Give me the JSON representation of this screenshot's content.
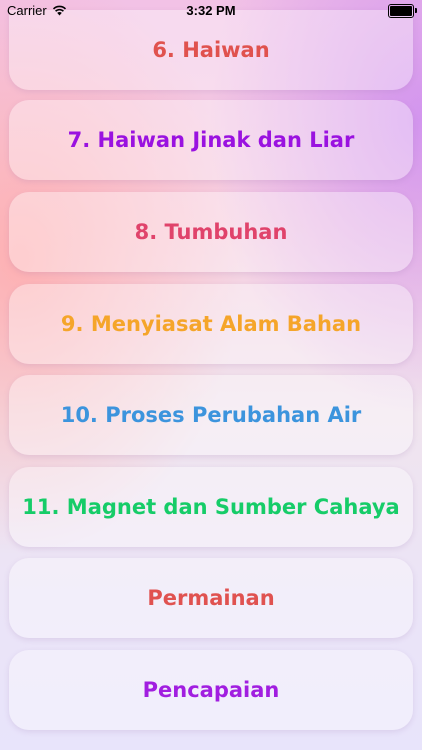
{
  "status_bar": {
    "carrier": "Carrier",
    "time": "3:32 PM",
    "battery_level": 1.0
  },
  "menu": {
    "items": [
      {
        "label": "6. Haiwan",
        "color": "#e0524e"
      },
      {
        "label": "7. Haiwan Jinak dan Liar",
        "color": "#9a12e0"
      },
      {
        "label": "8. Tumbuhan",
        "color": "#e0436b"
      },
      {
        "label": "9. Menyiasat Alam Bahan",
        "color": "#f5a52a"
      },
      {
        "label": "10. Proses Perubahan Air",
        "color": "#3c94dd"
      },
      {
        "label": "11. Magnet dan Sumber Cahaya",
        "color": "#16cc68"
      },
      {
        "label": "Permainan",
        "color": "#e05250"
      },
      {
        "label": "Pencapaian",
        "color": "#a11ee0"
      }
    ]
  }
}
